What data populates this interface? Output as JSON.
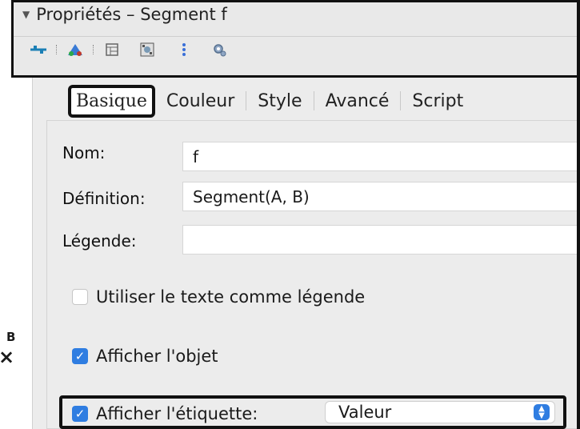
{
  "header": {
    "collapse_glyph": "▼",
    "title": "Propriétés – Segment f",
    "toolbar_icons": [
      "segment-tool-icon",
      "polygon-tool-icon",
      "table-icon",
      "image-icon",
      "dots-icon",
      "gear-icon"
    ]
  },
  "canvas": {
    "point_label": "B",
    "point_mark": "×"
  },
  "tabs": [
    {
      "label": "Basique",
      "active": true
    },
    {
      "label": "Couleur",
      "active": false
    },
    {
      "label": "Style",
      "active": false
    },
    {
      "label": "Avancé",
      "active": false
    },
    {
      "label": "Script",
      "active": false
    }
  ],
  "fields": {
    "name_label": "Nom:",
    "name_value": "f",
    "definition_label": "Définition:",
    "definition_value": "Segment(A, B)",
    "caption_label": "Légende:",
    "caption_value": ""
  },
  "checkboxes": {
    "use_text_caption": {
      "label": "Utiliser le texte comme légende",
      "checked": false
    },
    "show_object": {
      "label": "Afficher l'objet",
      "checked": true
    },
    "show_label": {
      "label": "Afficher l'étiquette:",
      "checked": true
    }
  },
  "label_select": {
    "value": "Valeur"
  },
  "colors": {
    "accent": "#2f7de1",
    "panel_bg": "#ececec",
    "highlight_border": "#111111"
  }
}
